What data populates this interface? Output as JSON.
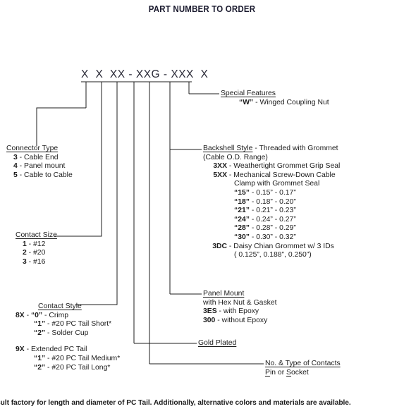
{
  "document": {
    "title": "PART NUMBER TO ORDER",
    "part_number_mask": "X  X  XX - XXG - XXX  X",
    "footnote": "sult factory for length and diameter of PC Tail. Additionally, alternative colors and materials are available.",
    "title_color": "#1a1a2e",
    "text_color": "#1c1c1c",
    "line_color": "#1c1c1c",
    "background_color": "#ffffff"
  },
  "callouts": {
    "special_features": {
      "heading": "Special Features",
      "options": [
        {
          "code": "“W”",
          "sep": " - ",
          "desc": "Winged Coupling Nut"
        }
      ]
    },
    "backshell_style": {
      "heading": "Backshell Style",
      "heading_suffix": " - Threaded with Grommet",
      "subtitle": "(Cable O.D. Range)",
      "options": [
        {
          "code": "3XX",
          "sep": " - ",
          "desc": "Weathertight Grommet Grip Seal"
        },
        {
          "code": "5XX",
          "sep": " - ",
          "desc": "Mechanical Screw-Down Cable"
        }
      ],
      "continuation": "Clamp with Grommet Seal",
      "ranges": [
        {
          "code": "“15”",
          "sep": " - ",
          "desc": "0.15” - 0.17”"
        },
        {
          "code": "“18”",
          "sep": " - ",
          "desc": "0.18” - 0.20”"
        },
        {
          "code": "“21”",
          "sep": " - ",
          "desc": "0.21” - 0.23”"
        },
        {
          "code": "“24”",
          "sep": " - ",
          "desc": "0.24” - 0.27”"
        },
        {
          "code": "“28”",
          "sep": " - ",
          "desc": "0.28” - 0.29”"
        },
        {
          "code": "“30”",
          "sep": " - ",
          "desc": "0.30” - 0.32”"
        }
      ],
      "daisy": {
        "code": "3DC",
        "sep": " - ",
        "desc": "Daisy Chian Grommet w/ 3 IDs"
      },
      "daisy_sub": "( 0.125”, 0.188”, 0.250”)"
    },
    "panel_mount": {
      "heading": "Panel Mount",
      "subtitle": "with Hex Nut & Gasket",
      "options": [
        {
          "code": "3ES",
          "sep": " - ",
          "desc": "with Epoxy"
        },
        {
          "code": "300",
          "sep": " - ",
          "desc": "without Epoxy"
        }
      ]
    },
    "gold_plated": {
      "heading": "Gold Plated"
    },
    "contacts": {
      "heading": "No. & Type of Contacts",
      "subtitle_p": "P",
      "subtitle_mid": "in or ",
      "subtitle_s": "S",
      "subtitle_end": "ocket"
    },
    "connector_type": {
      "heading": "Connector Type",
      "options": [
        {
          "code": "3",
          "sep": " - ",
          "desc": "Cable End"
        },
        {
          "code": "4",
          "sep": " - ",
          "desc": "Panel mount"
        },
        {
          "code": "5",
          "sep": " - ",
          "desc": "Cable to Cable"
        }
      ]
    },
    "contact_size": {
      "heading": "Contact Size",
      "options": [
        {
          "code": "1",
          "sep": " - ",
          "desc": "#12"
        },
        {
          "code": "2",
          "sep": " - ",
          "desc": "#20"
        },
        {
          "code": "3",
          "sep": " - ",
          "desc": "#16"
        }
      ]
    },
    "contact_style": {
      "heading": "Contact Style",
      "group_8x": {
        "code": "8X",
        "sep": " - ",
        "first": {
          "code": "“0”",
          "sep": " - ",
          "desc": "Crimp"
        },
        "rest": [
          {
            "code": "“1”",
            "sep": " - ",
            "desc": "#20 PC Tail Short*"
          },
          {
            "code": "“2”",
            "sep": " - ",
            "desc": "Solder Cup"
          }
        ]
      },
      "group_9x": {
        "code": "9X",
        "sep": " - ",
        "first_desc": "Extended PC Tail",
        "rest": [
          {
            "code": "“1”",
            "sep": " - ",
            "desc": "#20 PC Tail Medium*"
          },
          {
            "code": "“2”",
            "sep": " - ",
            "desc": "#20 PC Tail Long*"
          }
        ]
      }
    }
  }
}
